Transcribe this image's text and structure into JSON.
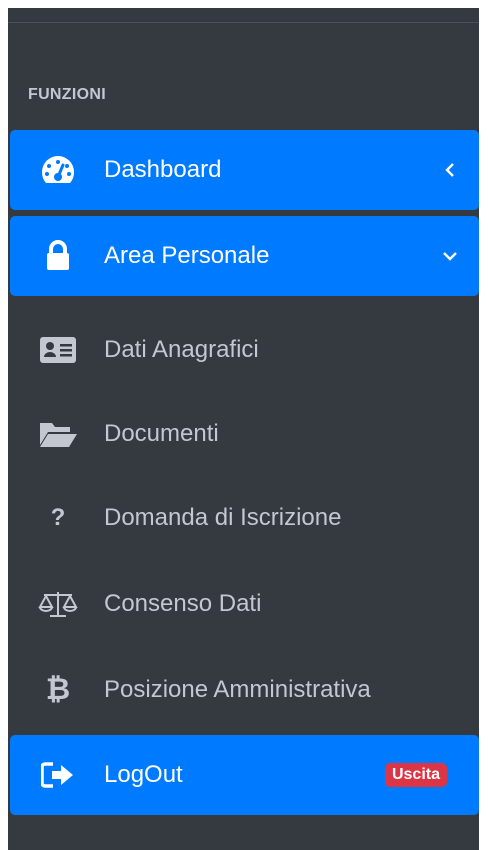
{
  "sidebar": {
    "section_header": "FUNZIONI",
    "items": [
      {
        "label": "Dashboard",
        "icon": "tachometer-icon",
        "active": true,
        "chevron": "left"
      },
      {
        "label": "Area Personale",
        "icon": "lock-icon",
        "active": true,
        "chevron": "down"
      },
      {
        "label": "Dati Anagrafici",
        "icon": "id-card-icon",
        "active": false
      },
      {
        "label": "Documenti",
        "icon": "folder-open-icon",
        "active": false
      },
      {
        "label": "Domanda di Iscrizione",
        "icon": "question-icon",
        "active": false
      },
      {
        "label": "Consenso Dati",
        "icon": "balance-scale-icon",
        "active": false
      },
      {
        "label": "Posizione Amministrativa",
        "icon": "bitcoin-icon",
        "active": false
      },
      {
        "label": "LogOut",
        "icon": "sign-out-icon",
        "active": true,
        "badge": "Uscita"
      }
    ]
  },
  "colors": {
    "sidebar_bg": "#343a40",
    "active_bg": "#007bff",
    "text": "#c2c7d0",
    "badge_bg": "#dc3545"
  }
}
